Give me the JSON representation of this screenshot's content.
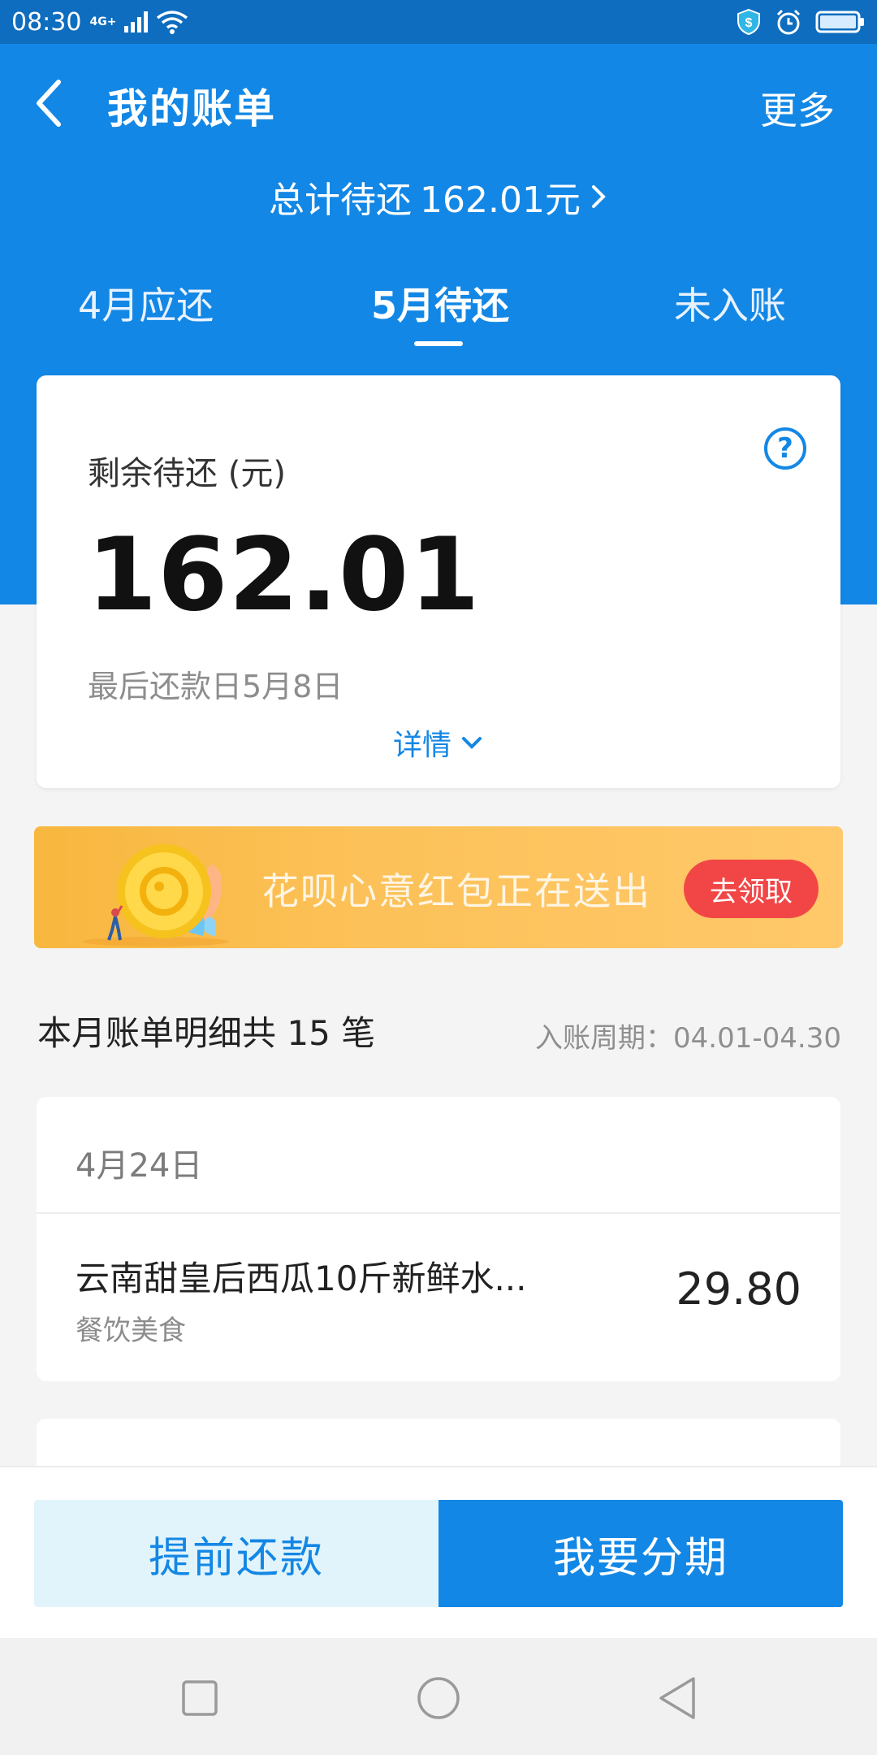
{
  "status_bar": {
    "time": "08:30",
    "network": "4G+",
    "icons": [
      "signal-icon",
      "wifi-icon",
      "shield-icon",
      "alarm-icon",
      "battery-icon"
    ]
  },
  "header": {
    "title": "我的账单",
    "more_label": "更多",
    "total_due_label": "总计待还",
    "total_due_amount": "162.01元"
  },
  "tabs": [
    {
      "label": "4月应还",
      "active": false
    },
    {
      "label": "5月待还",
      "active": true
    },
    {
      "label": "未入账",
      "active": false
    }
  ],
  "summary": {
    "remaining_label": "剩余待还 (元)",
    "remaining_amount": "162.01",
    "due_date": "最后还款日5月8日",
    "detail_label": "详情"
  },
  "promo": {
    "text": "花呗心意红包正在送出",
    "button_label": "去领取"
  },
  "bill_list": {
    "header": "本月账单明细共 15 笔",
    "cycle": "入账周期：04.01-04.30",
    "groups": [
      {
        "date": "4月24日",
        "items": [
          {
            "title": "云南甜皇后西瓜10斤新鲜水...",
            "category": "餐饮美食",
            "amount": "29.80"
          }
        ]
      }
    ]
  },
  "actions": {
    "prepay_label": "提前还款",
    "installment_label": "我要分期"
  },
  "colors": {
    "brand_blue": "#1387e5",
    "status_bar": "#0e6dbf",
    "promo_button": "#f24646",
    "promo_bg": "#fcc158"
  }
}
